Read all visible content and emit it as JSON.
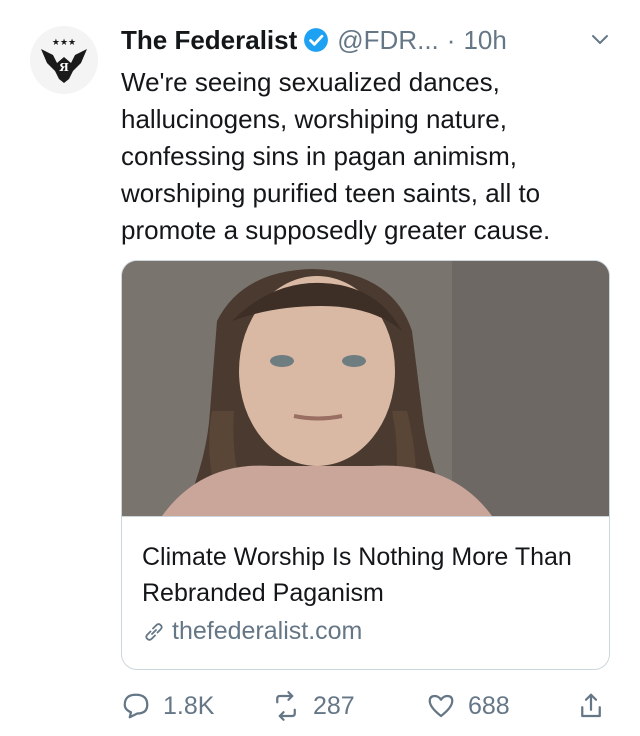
{
  "account": {
    "name": "The Federalist",
    "handle": "@FDR...",
    "separator": "·",
    "time": "10h",
    "avatar_icon": "eagle-logo-icon",
    "verified_icon": "verified-badge-icon"
  },
  "tweet": {
    "text": "We're seeing sexualized dances, hallucinogens, worshiping nature, confessing sins in pagan animism, worshiping purified teen saints, all to promote a supposedly greater cause."
  },
  "card": {
    "title": "Climate Worship Is Nothing More Than Rebranded Paganism",
    "domain": "thefederalist.com",
    "image_icon": "article-photo"
  },
  "actions": {
    "reply_count": "1.8K",
    "retweet_count": "287",
    "like_count": "688"
  },
  "colors": {
    "text": "#14171a",
    "secondary": "#657786",
    "verified": "#1da1f2",
    "border": "#ccd6dd"
  }
}
